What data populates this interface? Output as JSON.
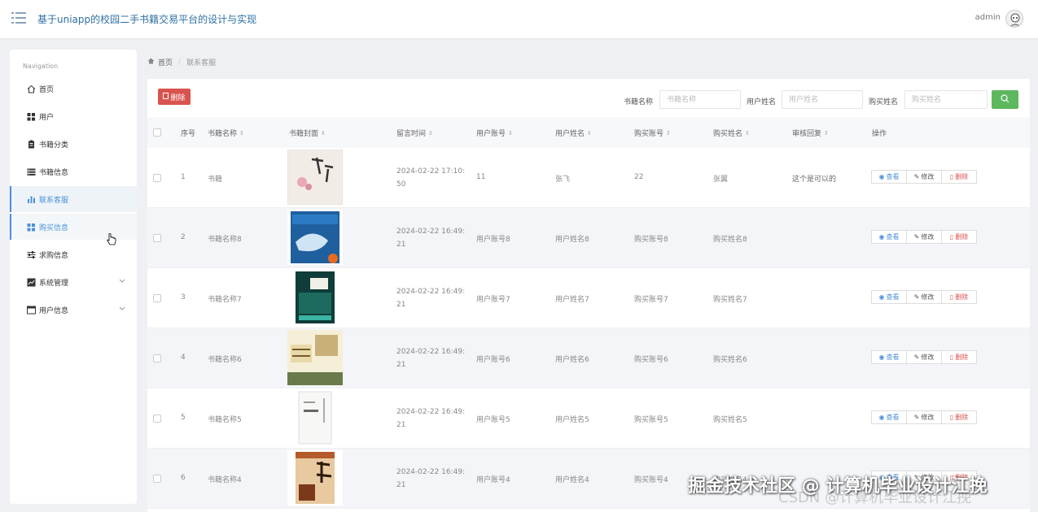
{
  "header": {
    "title": "基于uniapp的校园二手书籍交易平台的设计与实现",
    "user": "admin"
  },
  "sidebar": {
    "title": "Navigation",
    "items": [
      {
        "label": "首页",
        "icon": "home-icon"
      },
      {
        "label": "用户",
        "icon": "grid-icon"
      },
      {
        "label": "书籍分类",
        "icon": "clipboard-icon"
      },
      {
        "label": "书籍信息",
        "icon": "list-icon"
      },
      {
        "label": "联系客服",
        "icon": "bar-chart-icon",
        "active": true
      },
      {
        "label": "购买信息",
        "icon": "grid-icon"
      },
      {
        "label": "求购信息",
        "icon": "sliders-icon"
      },
      {
        "label": "系统管理",
        "icon": "chart-icon",
        "expandable": true
      },
      {
        "label": "用户信息",
        "icon": "window-icon",
        "expandable": true
      }
    ]
  },
  "breadcrumb": {
    "home": "首页",
    "sep": "/",
    "current": "联系客服"
  },
  "toolbar": {
    "delete_label": "删除",
    "filters": [
      {
        "label": "书籍名称",
        "placeholder": "书籍名称"
      },
      {
        "label": "用户姓名",
        "placeholder": "用户姓名"
      },
      {
        "label": "购买姓名",
        "placeholder": "购买姓名"
      }
    ]
  },
  "table": {
    "columns": [
      "序号",
      "书籍名称",
      "书籍封面",
      "留言时间",
      "用户账号",
      "用户姓名",
      "购买账号",
      "购买姓名",
      "审核回复",
      "操作"
    ],
    "actions": {
      "view": "查看",
      "edit": "修改",
      "delete": "删除"
    },
    "rows": [
      {
        "index": "1",
        "book": "书籍",
        "time": "2024-02-22 17:10:50",
        "account": "11",
        "name": "张飞",
        "buy_account": "22",
        "buy_name": "张翼",
        "reply": "这个是可以的"
      },
      {
        "index": "2",
        "book": "书籍名称8",
        "time": "2024-02-22 16:49:21",
        "account": "用户账号8",
        "name": "用户姓名8",
        "buy_account": "购买账号8",
        "buy_name": "购买姓名8",
        "reply": ""
      },
      {
        "index": "3",
        "book": "书籍名称7",
        "time": "2024-02-22 16:49:21",
        "account": "用户账号7",
        "name": "用户姓名7",
        "buy_account": "购买账号7",
        "buy_name": "购买姓名7",
        "reply": ""
      },
      {
        "index": "4",
        "book": "书籍名称6",
        "time": "2024-02-22 16:49:21",
        "account": "用户账号6",
        "name": "用户姓名6",
        "buy_account": "购买账号6",
        "buy_name": "购买姓名6",
        "reply": ""
      },
      {
        "index": "5",
        "book": "书籍名称5",
        "time": "2024-02-22 16:49:21",
        "account": "用户账号5",
        "name": "用户姓名5",
        "buy_account": "购买账号5",
        "buy_name": "购买姓名5",
        "reply": ""
      },
      {
        "index": "6",
        "book": "书籍名称4",
        "time": "2024-02-22 16:49:21",
        "account": "用户账号4",
        "name": "用户姓名4",
        "buy_account": "购买账号4",
        "buy_name": "购买姓名4",
        "reply": ""
      }
    ]
  },
  "watermark": {
    "main": "掘金技术社区 @ 计算机毕业设计江挽",
    "sub": "CSDN @计算机毕业设计江挽"
  }
}
